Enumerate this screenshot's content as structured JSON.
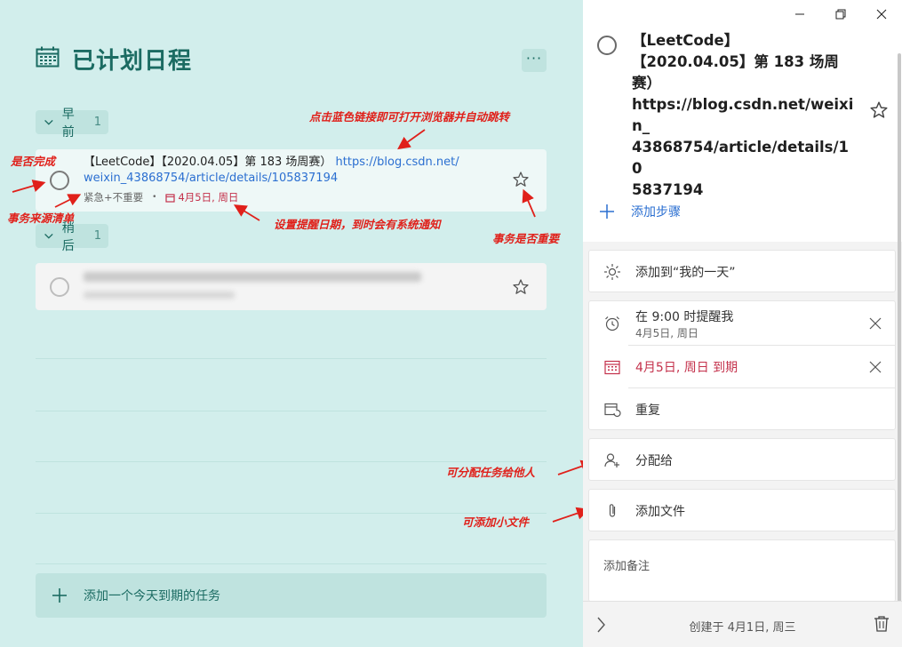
{
  "list": {
    "title": "已计划日程",
    "more_label": "···",
    "groups": [
      {
        "label": "早前",
        "count": "1"
      },
      {
        "label": "稍后",
        "count": "1"
      }
    ],
    "add_task_label": "添加一个今天到期的任务"
  },
  "tasks": [
    {
      "title_prefix": "【LeetCode】【2020.04.05】第 183 场周赛）",
      "link": "https://blog.csdn.net/weixin_43868754/article/details/105837194",
      "link_line1": "https://blog.csdn.net/",
      "link_line2": "weixin_43868754/article/details/105837194",
      "source_list": "紧急+不重要",
      "separator": "•",
      "due": "4月5日, 周日",
      "completed": false,
      "important": false
    },
    {
      "title": "",
      "blurred": true,
      "completed": false,
      "important": false
    }
  ],
  "annotations": {
    "link_hint": "点击蓝色链接即可打开浏览器并自动跳转",
    "complete_hint": "是否完成",
    "source_hint": "事务来源清单",
    "reminder_hint": "设置提醒日期，到时会有系统通知",
    "important_hint": "事务是否重要",
    "assign_hint": "可分配任务给他人",
    "file_hint": "可添加小文件"
  },
  "detail": {
    "title": "【LeetCode】【2020.04.05】第 183 场周赛）https://blog.csdn.net/weixin_43868754/article/details/105837194",
    "title_lines": [
      "【LeetCode】",
      "【2020.04.05】第 183 场周",
      "赛）",
      "https://blog.csdn.net/weixi",
      "n_",
      "43868754/article/details/10",
      "5837194"
    ],
    "add_step_label": "添加步骤",
    "my_day_label": "添加到“我的一天”",
    "reminder_label": "在 9:00 时提醒我",
    "reminder_sub": "4月5日, 周日",
    "due_label": "4月5日, 周日 到期",
    "repeat_label": "重复",
    "assign_label": "分配给",
    "file_label": "添加文件",
    "note_placeholder": "添加备注",
    "created_label": "创建于 4月1日, 周三"
  },
  "colors": {
    "accent": "#1b6b62",
    "background": "#d2eeec",
    "link": "#2b6fd1",
    "due_red": "#c4314b",
    "annotation_red": "#e0201a"
  }
}
